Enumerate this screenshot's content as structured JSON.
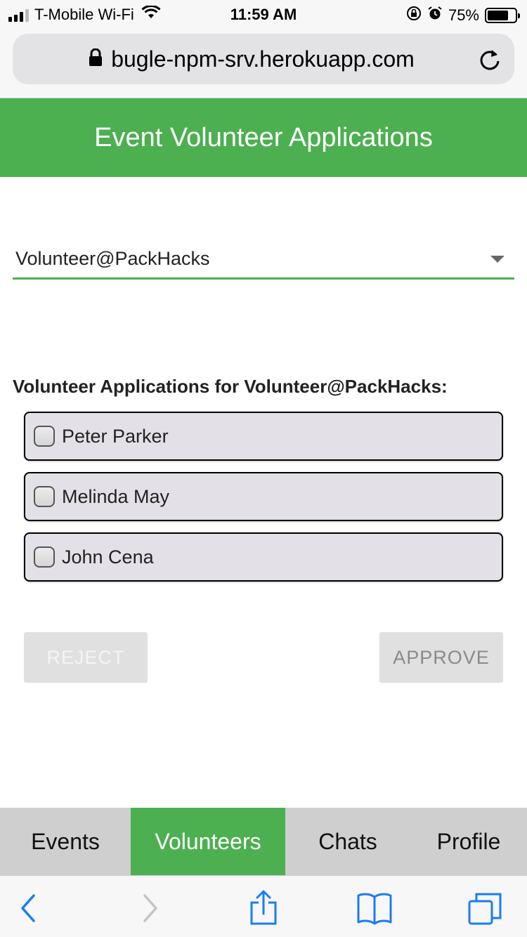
{
  "status_bar": {
    "carrier": "T-Mobile Wi-Fi",
    "time": "11:59 AM",
    "battery_percent": "75%",
    "battery_level": 0.75,
    "icons": [
      "signal-icon",
      "wifi-icon",
      "orientation-lock-icon",
      "alarm-icon",
      "battery-icon"
    ]
  },
  "browser": {
    "url": "bugle-npm-srv.herokuapp.com",
    "icons": [
      "lock-icon",
      "reload-icon"
    ]
  },
  "header": {
    "title": "Event Volunteer Applications"
  },
  "event_select": {
    "selected_value": "Volunteer@PackHacks"
  },
  "applications": {
    "heading": "Volunteer Applications for Volunteer@PackHacks:",
    "items": [
      {
        "name": "Peter Parker",
        "checked": false
      },
      {
        "name": "Melinda May",
        "checked": false
      },
      {
        "name": "John Cena",
        "checked": false
      }
    ]
  },
  "actions": {
    "reject_label": "REJECT",
    "approve_label": "APPROVE"
  },
  "tab_nav": {
    "tabs": [
      {
        "label": "Events",
        "active": false
      },
      {
        "label": "Volunteers",
        "active": true
      },
      {
        "label": "Chats",
        "active": false
      },
      {
        "label": "Profile",
        "active": false
      }
    ]
  },
  "safari_toolbar": {
    "icons": [
      "back-icon",
      "forward-icon",
      "share-icon",
      "bookmarks-icon",
      "tabs-icon"
    ]
  },
  "colors": {
    "accent": "#4caf50",
    "ios_blue": "#1a7cf6",
    "item_background": "#e3e1e7"
  }
}
